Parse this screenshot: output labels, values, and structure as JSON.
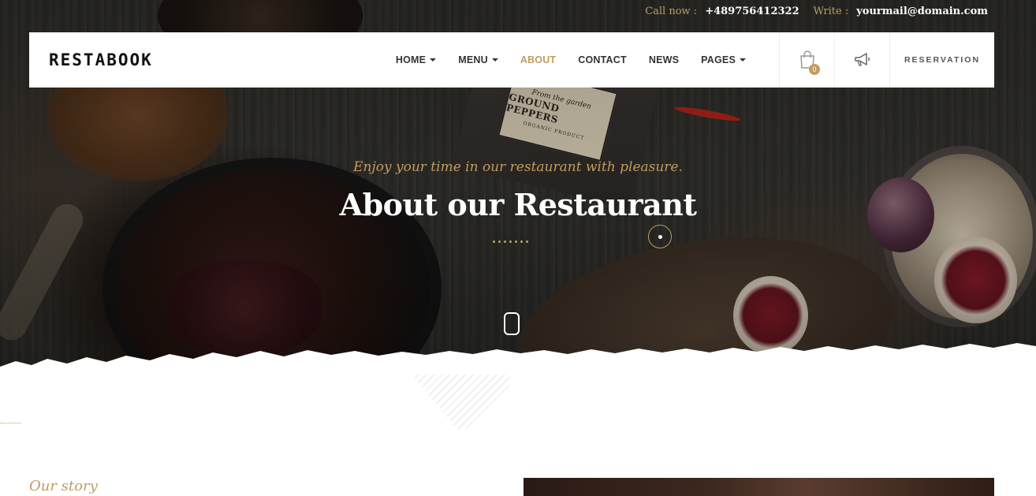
{
  "topbar": {
    "call_label": "Call now :",
    "phone": "+489756412322",
    "write_label": "Write :",
    "email": "yourmail@domain.com"
  },
  "header": {
    "logo": "RESTABOOK",
    "nav": [
      {
        "label": "HOME",
        "dropdown": true
      },
      {
        "label": "MENU",
        "dropdown": true
      },
      {
        "label": "ABOUT",
        "active": true
      },
      {
        "label": "CONTACT"
      },
      {
        "label": "NEWS"
      },
      {
        "label": "PAGES",
        "dropdown": true
      }
    ],
    "cart_count": "0",
    "cart_icon": "shopping-bag-icon",
    "announce_icon": "megaphone-icon",
    "reservation_label": "RESERVATION"
  },
  "hero": {
    "subtitle": "Enjoy your time in our restaurant with pleasure.",
    "title": "About our Restaurant",
    "bag_line1": "From the garden",
    "bag_line2": "GROUND PEPPERS",
    "bag_line3": "ORGANIC PRODUCT"
  },
  "section": {
    "story_label": "Our story"
  },
  "colors": {
    "accent": "#c19d60",
    "text_dark": "#333333",
    "white": "#ffffff"
  }
}
